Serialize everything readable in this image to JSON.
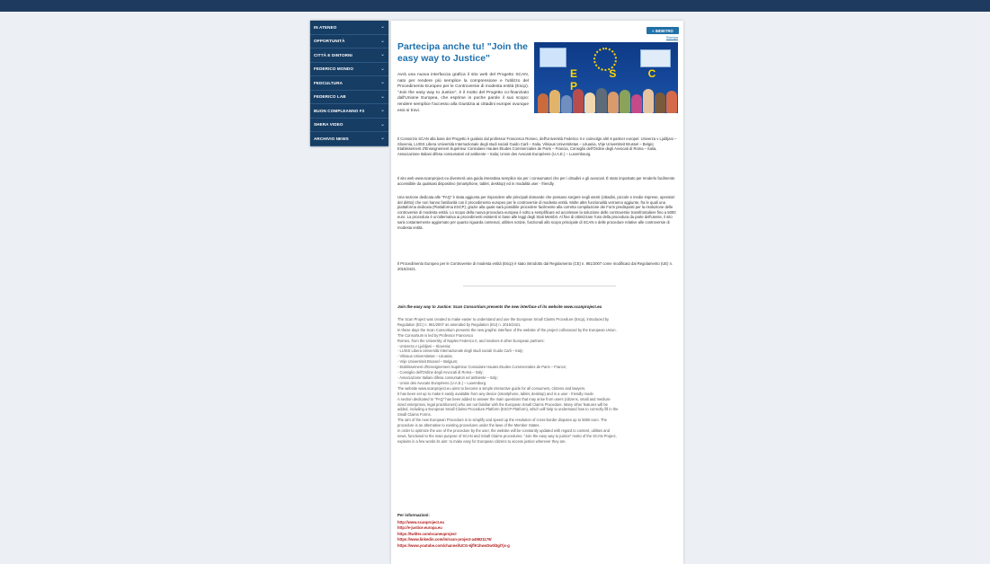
{
  "menu": {
    "items": [
      {
        "label": "IN ATENEO"
      },
      {
        "label": "OPPORTUNITÀ"
      },
      {
        "label": "CITTÀ E DINTORNI"
      },
      {
        "label": "FEDERICO MONDO"
      },
      {
        "label": "FEDCULTURA"
      },
      {
        "label": "FEDERICO LAB"
      },
      {
        "label": "BUON COMPLEANNO F2"
      },
      {
        "label": "SHERA VIDEO"
      },
      {
        "label": "ARCHIVIO NEWS"
      }
    ]
  },
  "article": {
    "back_label": "« INDIETRO",
    "print_label": "Stampa",
    "title": "Partecipa anche tu! \"Join the easy way to Justice\"",
    "hero_text": "E S C P",
    "intro": "Avrà una nuova interfaccia grafica il sito web del Progetto SCAN, nato per rendere più semplice la comprensione e l'utilizzo del Procedimento Europeo per le Controversie di modesta entità (Escp). \"Join the easy way to Justice\", è il motto del Progetto co-finanziato dall'Unione Europea, che esprime in poche parole il suo scopo: rendere semplice l'accesso alla Giustizia ai cittadini europei ovunque essi si trovi.",
    "p1": "Il Consorzio SCAN alla base del Progetto è guidato dal professor Francesco Romeo, dell'Università Federico II e coinvolge altri 8 partner europei: Univerza v Ljubljani – Slovenia, LUISS Libera Università Internazionale degli studi sociali Guido Carli – Italia, Vilniaus Universitetas – Lituania, Vrije Universiteit Brussel – Belgio; Etablissement d'Enseignement Supérieur Consulaire Hautes Etudes Commerciales de Paris – Francia, Consiglio dell'Ordine degli Avvocati di Roma – Italia, Associazione Italiani difesa consumatori ed ambiente – Italia; Union des Avocats Européens (U.A.E.) – Luxembourg.",
    "p2": "Il sito web www.scanproject.eu diventerà una guida interattiva semplice sia per i consumatori che per i cittadini e gli avvocati. È stato impostato per renderlo facilmente accessibile da qualsiasi dispositivo (smartphone, tablet, desktop) ed in modalità user - friendly.",
    "p3": "Una sezione dedicata alle \"FAQ\" è stata aggiunta per rispondere alle principali domande che possano sorgere negli utenti (cittadini, piccole e medie imprese, operatori del diritto) che non hanno familiarità con il procedimento europeo per le controversie di modesta entità. Molte altre funzionalità verranno aggiunte, fra le quali una piattaforma dedicata (Piattaforma ESCP), grazie alla quale sarà possibile procedere facilmente alla corretta compilazione dei Form predisposti per la risoluzione delle controversie di modesta entità. Lo scopo della nuova procedura europea è volto a semplificare ed accelerare la soluzione delle controversie transfrontaliere fino a 5000 euro. La procedura è un'alternativa ai procedimenti esistenti in base alle leggi degli Stati Membri. Al fine di ottimizzare l'uso della procedura da parte dell'utente, il sito sarà costantemente aggiornato per quanto riguarda contenuti, utilities notizie, funzionali allo scopo principale di SCAN e delle procedure relative alle controversie di modesta entità.",
    "p4": "Il Procedimento Europeo per le Controversie di modesta entità (Escp) è stato introdotto dal Regolamento (CE) n. 861/2007 come modificato dal Regolamento (UE) n. 2015/2421.",
    "english_title": "Join the easy way to Justice: Scan Consortium presents the new interface of its website www.scanproject.eu",
    "english_lines": [
      "The Scan Project was created to make easier to understand and use the European Small Claims Procedure (Escp), introduced by",
      "Regulation (EC) n. 861/2007 as amended by Regulation (EU) n. 2015/2421.",
      "In these days the Scan Consortium presents the new graphic interface of the website of the project cofinanced by the European Union.",
      "The Consortium is led by Professor Francesco",
      "Romeo, from the University of Naples Federico II, and involves 8 other European partners:",
      "- Univerza v Ljubljani – Slovenia;",
      "- LUISS Libera Università Internazionale degli studi sociali Guido Carli – Italy;",
      "- Vilniaus Universitetas – Lituania;",
      "- Vrije Universiteit Brussel – Belgium;",
      "- Etablissement d'Enseignement Supérieur Consulaire Hautes Etudes Commerciales de Paris – France;",
      "- Consiglio dell'Ordine degli Avvocati di Roma – Italy;",
      "- Associazione Italiani difesa consumatori ed ambiente – Italy;",
      "- Union des Avocats Européens (U.A.E.) – Luxemburg.",
      "The website www.scanproject.eu aims to become a simple interactive guide for all consumers, citizens and lawyers.",
      "It has been set up to make it easily available from any device (smartphone, tablet, desktop) and in a user - friendly mode.",
      "A section dedicated to \"FAQ\" has been added to answer the main questions that may arise from users (citizens, small and medium-",
      "sized enterprises, legal practitioners) who are not familiar with the European Small Claims Procedure. Many other features will be",
      "added, including a European Small Claims Procedure Platform (ESCP Platform), which will help to understand how to correctly fill in the",
      "Small Claims Forms.",
      "The aim of the new European Procedure is to simplify and speed up the resolution of cross-border disputes up to 5000 euro. The",
      "procedure is an alternative to existing procedures under the laws of the Member States.",
      "In order to optimize the use of the procedure by the user, the website will be constantly updated with regard to content, utilities and",
      "news, functional to the main purpose of SCAN and Small Claims procedures. \"Join the easy way to justice\" motto of the SCAN Project,",
      "explains in a few words its aim: to make easy for European citizens to access justice wherever they are."
    ],
    "info_title": "Per informazioni:",
    "links": [
      "http://www.scanproject.eu",
      "http://e-justice.europa.eu",
      "https://twitter.com/scaneuproject",
      "https://www.linkedin.com/in/scan-project-a49821179/",
      "https://www.youtube.com/channel/UCG-6jflK1hwsDw0l3gl7js-g"
    ]
  }
}
